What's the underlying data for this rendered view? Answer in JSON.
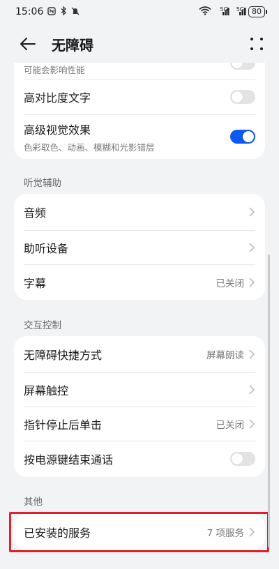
{
  "status_bar": {
    "time": "15:06",
    "signal_1": "5G",
    "signal_2": "5G",
    "battery": "80"
  },
  "app_bar": {
    "title": "无障碍"
  },
  "display_card": {
    "partial_text": "可能会影响性能",
    "high_contrast": {
      "label": "高对比度文字",
      "enabled": false
    },
    "advanced_visual": {
      "label": "高级视觉效果",
      "sub": "色彩取色、动画、模糊和光影错层",
      "enabled": true
    }
  },
  "hearing": {
    "section_title": "听觉辅助",
    "items": [
      {
        "label": "音频",
        "value": ""
      },
      {
        "label": "助听设备",
        "value": ""
      },
      {
        "label": "字幕",
        "value": "已关闭"
      }
    ]
  },
  "interaction": {
    "section_title": "交互控制",
    "items": [
      {
        "label": "无障碍快捷方式",
        "value": "屏幕朗读"
      },
      {
        "label": "屏幕触控",
        "value": ""
      },
      {
        "label": "指针停止后单击",
        "value": "已关闭"
      }
    ],
    "power_end_call": {
      "label": "按电源键结束通话",
      "enabled": false
    }
  },
  "other": {
    "section_title": "其他",
    "installed_services": {
      "label": "已安装的服务",
      "value": "7 项服务"
    }
  },
  "colors": {
    "accent": "#0a59f7",
    "highlight": "#e0202c",
    "background": "#f1f3f5"
  }
}
